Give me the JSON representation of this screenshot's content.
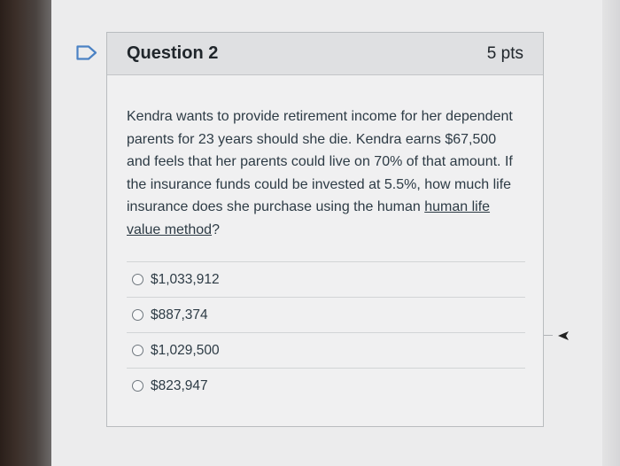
{
  "question": {
    "title": "Question 2",
    "points": "5 pts",
    "text_parts": {
      "before_link": "Kendra wants to provide retirement income for her dependent parents for 23 years should she die. Kendra earns $67,500 and feels that her parents could live on 70% of that amount. If the insurance funds could be invested at 5.5%, how much life insurance does she purchase using the human ",
      "link": "human life value method",
      "after_link": "?"
    },
    "answers": [
      {
        "label": "$1,033,912",
        "selected": false
      },
      {
        "label": "$887,374",
        "selected": false
      },
      {
        "label": "$1,029,500",
        "selected": false
      },
      {
        "label": "$823,947",
        "selected": false
      }
    ]
  },
  "icons": {
    "flag": "bookmark-flag-icon",
    "pointer": "mouse-pointer-icon"
  },
  "colors": {
    "header_bg": "#dfe0e2",
    "card_bg": "#f0f0f1",
    "text": "#2d3b45"
  }
}
